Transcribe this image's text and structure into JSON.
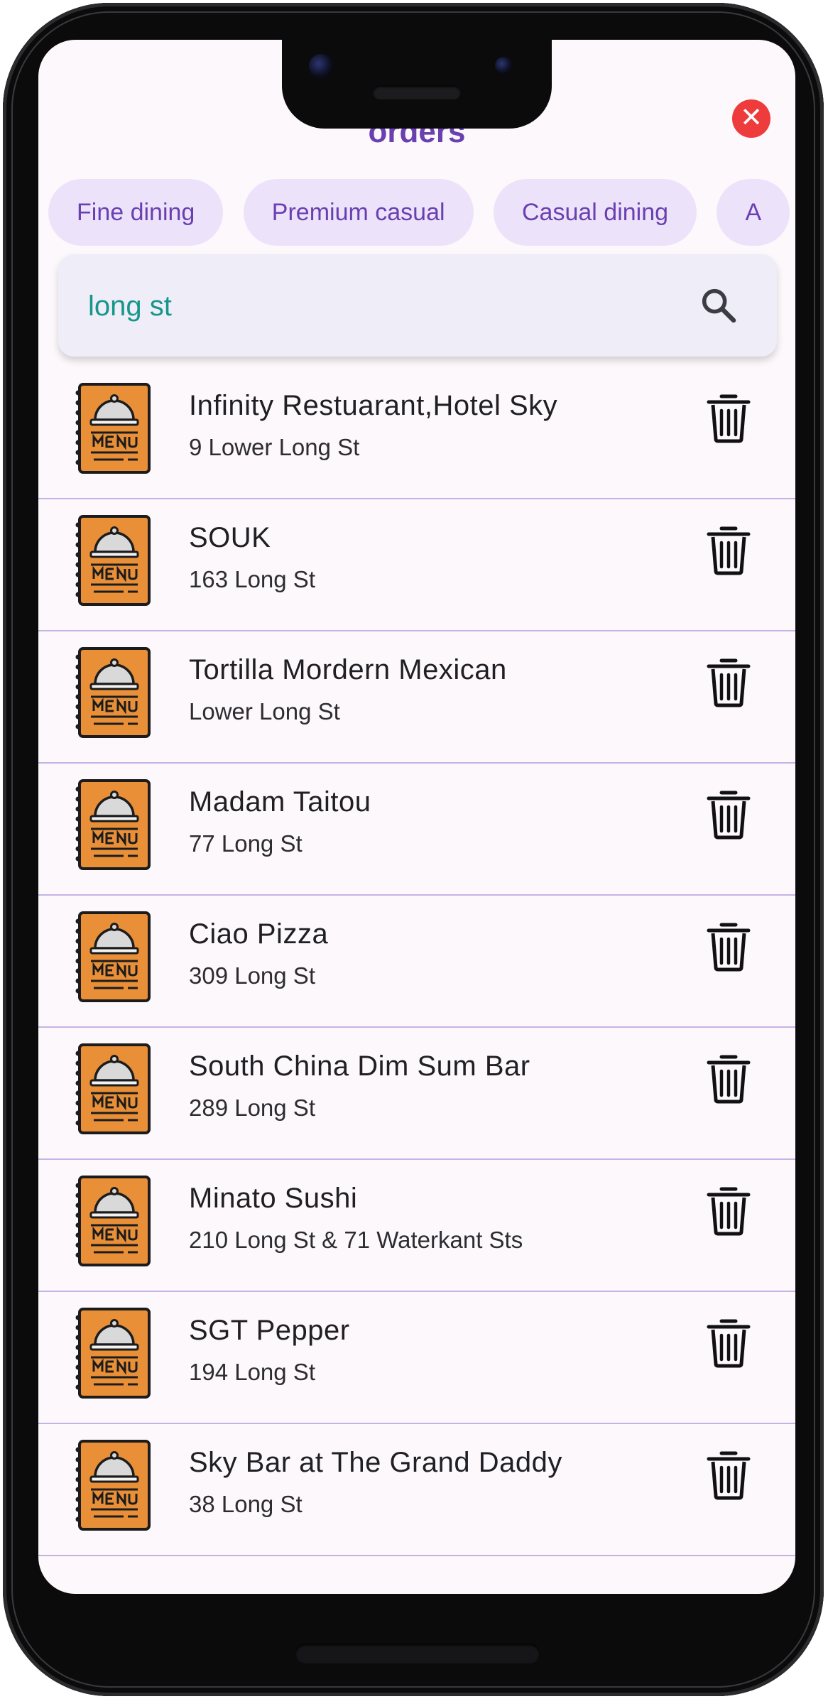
{
  "app": {
    "title": "orders",
    "close_symbol": "✕"
  },
  "filters": {
    "chips": [
      "Fine dining",
      "Premium casual",
      "Casual dining",
      "A"
    ]
  },
  "search": {
    "value": "long st",
    "icon": "search-icon"
  },
  "restaurants": [
    {
      "name": "Infinity Restuarant,Hotel Sky",
      "address": "9 Lower Long St"
    },
    {
      "name": "SOUK",
      "address": "163 Long St"
    },
    {
      "name": "Tortilla Mordern Mexican",
      "address": "Lower Long St"
    },
    {
      "name": "Madam Taitou",
      "address": "77 Long St"
    },
    {
      "name": "Ciao Pizza",
      "address": "309 Long St"
    },
    {
      "name": "South China Dim Sum Bar",
      "address": "289 Long St"
    },
    {
      "name": "Minato Sushi",
      "address": "210 Long St & 71 Waterkant Sts"
    },
    {
      "name": "SGT Pepper",
      "address": "194 Long St"
    },
    {
      "name": "Sky Bar at The Grand Daddy",
      "address": "38 Long St"
    }
  ],
  "icons": {
    "row_image": "menu-book-icon",
    "row_action": "trash-icon"
  },
  "colors": {
    "accent": "#6a3fb0",
    "chip_bg": "#ece3fb",
    "search_text": "#16978a",
    "close_button": "#ee3b3b",
    "menu_icon": "#e88f38",
    "divider": "#c6b3e6",
    "screen_bg": "#fdf8fb"
  }
}
